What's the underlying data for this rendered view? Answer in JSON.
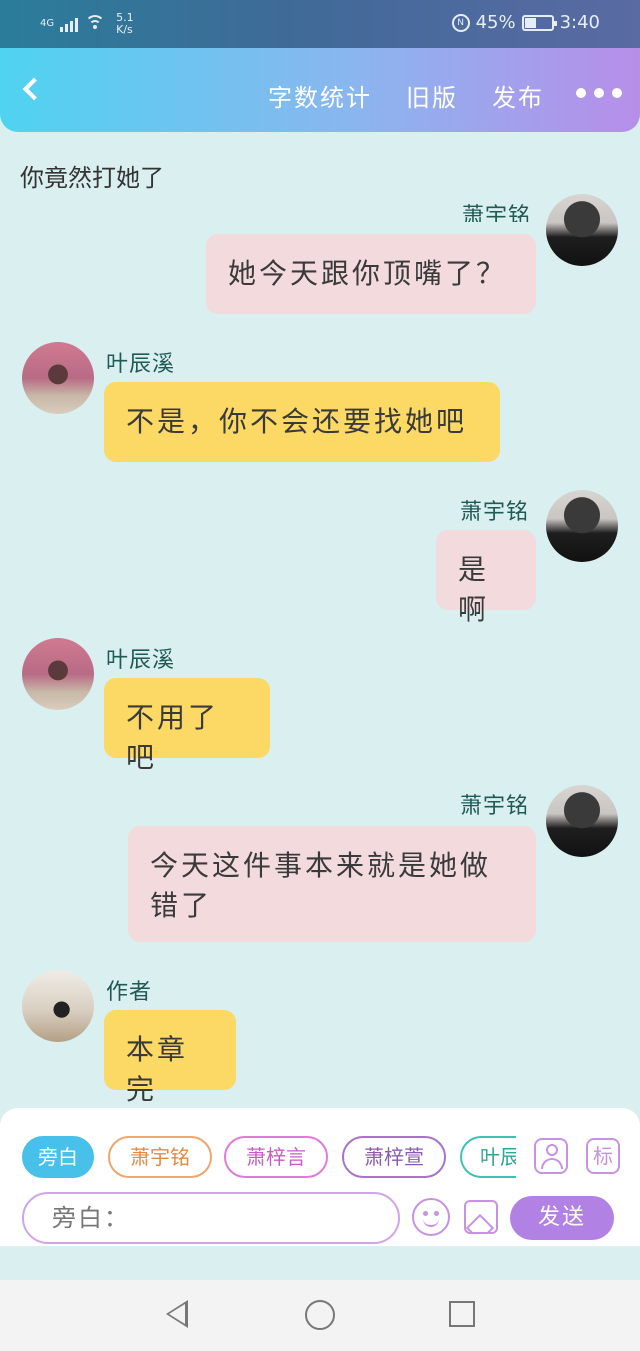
{
  "status_bar": {
    "network": "4G",
    "speed_value": "5.1",
    "speed_unit": "K/s",
    "battery": "45%",
    "battery_level": 0.45,
    "time": "3:40"
  },
  "header": {
    "back_icon": "chevron-left-icon",
    "word_count": "字数统计",
    "old_version": "旧版",
    "publish": "发布",
    "more_icon": "more-dots-icon"
  },
  "narration": "你竟然打她了",
  "messages": [
    {
      "side": "right",
      "name": "萧宇铭",
      "text": "她今天跟你顶嘴了？",
      "color": "pink"
    },
    {
      "side": "left",
      "name": "叶辰溪",
      "text": "不是，你不会还要找她吧",
      "color": "yellow"
    },
    {
      "side": "right",
      "name": "萧宇铭",
      "text": "是啊",
      "color": "pink"
    },
    {
      "side": "left",
      "name": "叶辰溪",
      "text": "不用了吧",
      "color": "yellow"
    },
    {
      "side": "right",
      "name": "萧宇铭",
      "text": "今天这件事本来就是她做错了",
      "color": "pink"
    },
    {
      "side": "left",
      "name": "作者",
      "text": "本章完",
      "color": "yellow"
    }
  ],
  "composer": {
    "chips": [
      "旁白",
      "萧宇铭",
      "萧梓言",
      "萧梓萱",
      "叶辰溪"
    ],
    "chip_colors": [
      "#47c0ea",
      "#f0a56a",
      "#e07ad8",
      "#a774c9",
      "#3fc2b0"
    ],
    "selected_chip": "旁白",
    "person_icon": "person-icon",
    "tag_label": "标",
    "input_placeholder": "旁白：",
    "emoji_icon": "emoji-icon",
    "image_icon": "image-icon",
    "send_label": "发送"
  },
  "nav": {
    "back_icon": "nav-back-icon",
    "home_icon": "nav-home-icon",
    "recent_icon": "nav-recent-icon"
  }
}
